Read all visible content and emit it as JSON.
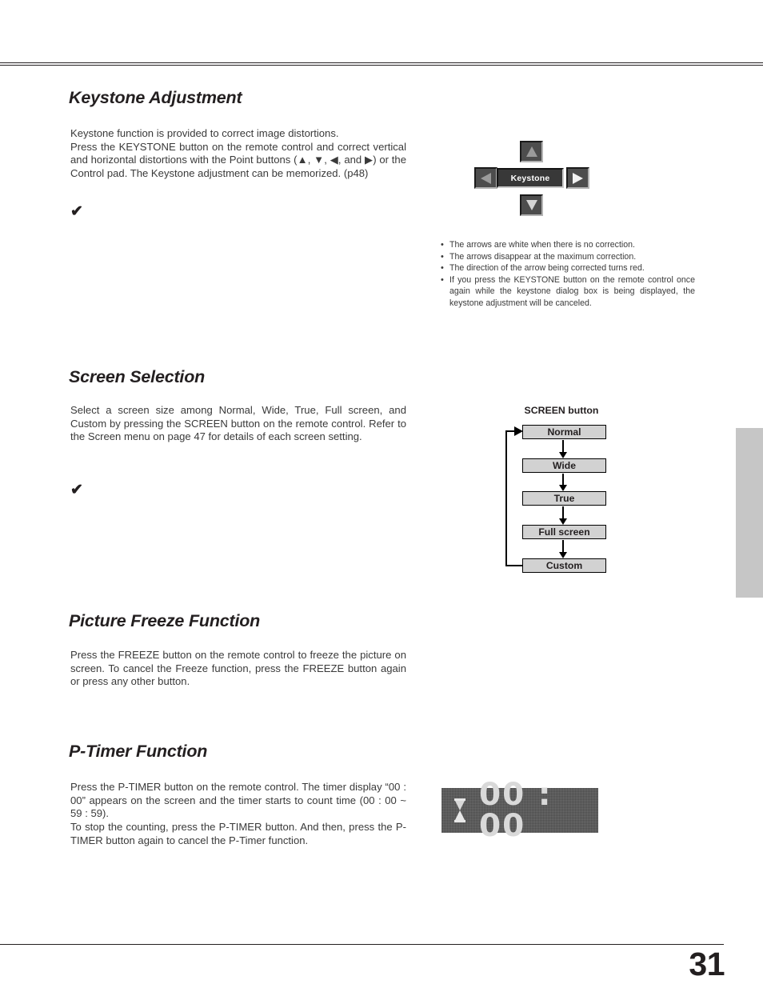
{
  "page": {
    "number": "31",
    "side_tab_color": "#c6c6c6"
  },
  "sections": {
    "keystone": {
      "heading": "Keystone Adjustment",
      "paragraph_line1": "Keystone function is provided to correct image distortions.",
      "paragraph_line2": "Press the KEYSTONE button on the remote control and correct vertical and horizontal distortions with the Point buttons (▲, ▼, ◀, and ▶) or the Control pad. The Keystone adjustment can be memorized. (p48)",
      "check_mark": "✔",
      "dialog": {
        "label": "Keystone",
        "up_arrow": "▲",
        "down_arrow": "▼",
        "left_arrow": "◀",
        "right_arrow": "▶"
      },
      "notes": [
        "The arrows are white when there is no correction.",
        "The arrows disappear at the maximum correction.",
        "The direction of the arrow being corrected turns red.",
        "If you press the KEYSTONE button on the remote control once again while the keystone dialog box is being displayed, the keystone adjustment will be canceled."
      ]
    },
    "screen_selection": {
      "heading": "Screen Selection",
      "paragraph": "Select a screen size among Normal, Wide, True, Full screen, and Custom by pressing the SCREEN button on the remote control. Refer to the Screen menu on page 47 for details of each screen setting.",
      "check_mark": "✔",
      "figure": {
        "title": "SCREEN button",
        "steps": [
          "Normal",
          "Wide",
          "True",
          "Full screen",
          "Custom"
        ]
      }
    },
    "picture_freeze": {
      "heading": "Picture Freeze Function",
      "paragraph": "Press the FREEZE button on the remote control to freeze the picture on screen. To cancel the Freeze function, press the FREEZE button again or press any other button."
    },
    "p_timer": {
      "heading": "P-Timer Function",
      "paragraph_block1": "Press the P-TIMER button on the remote control. The timer display “00 : 00” appears on the screen and the timer starts to count time (00 : 00 ~ 59 : 59).",
      "paragraph_block2": "To stop the counting, press the P-TIMER button. And then, press the P-TIMER button again to cancel the  P-Timer function.",
      "display": {
        "time": "00 : 00",
        "icon": "hourglass-icon"
      }
    }
  }
}
